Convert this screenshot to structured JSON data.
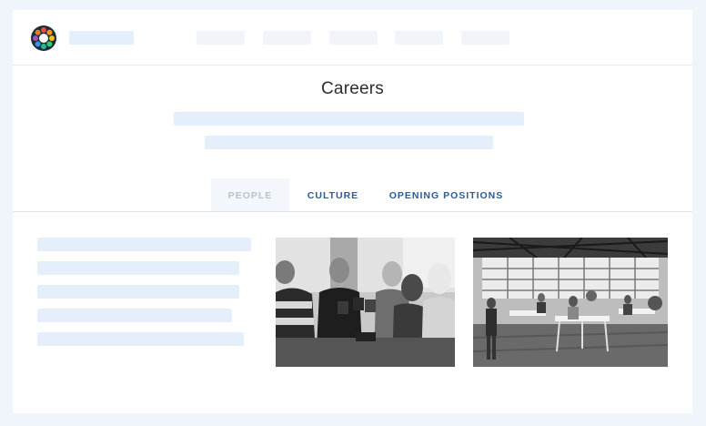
{
  "header": {
    "logo_icon": "colorful-ring-logo-icon",
    "nav_item_count": 5
  },
  "hero": {
    "title": "Careers"
  },
  "tabs": [
    {
      "label": "PEOPLE",
      "active": true
    },
    {
      "label": "CULTURE",
      "active": false
    },
    {
      "label": "OPENING POSITIONS",
      "active": false
    }
  ],
  "photos": [
    {
      "name": "team-toast-photo",
      "description_icon": "grayscale-photo-icon"
    },
    {
      "name": "open-office-photo",
      "description_icon": "grayscale-photo-icon"
    }
  ],
  "colors": {
    "background": "#f0f5fb",
    "placeholder": "#e5eefb",
    "tab_text": "#2f5b94",
    "tab_active_text": "#b7c2ce"
  }
}
